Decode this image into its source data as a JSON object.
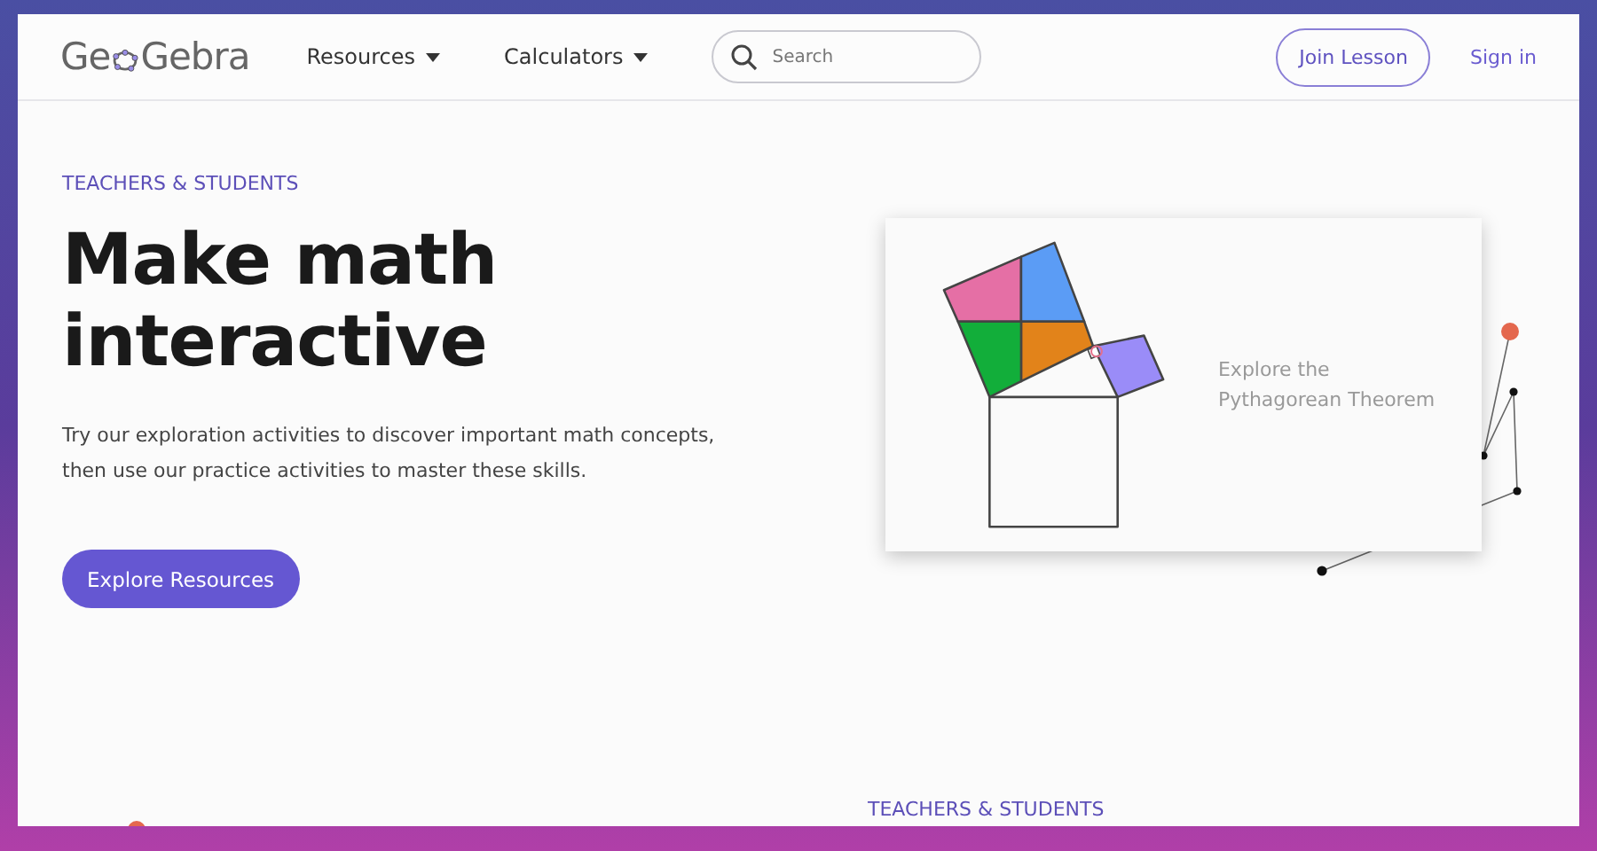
{
  "header": {
    "logo_start": "Ge",
    "logo_end": "Gebra",
    "nav": [
      {
        "label": "Resources"
      },
      {
        "label": "Calculators"
      }
    ],
    "search": {
      "placeholder": "Search"
    },
    "join_button": "Join Lesson",
    "sign_in": "Sign in"
  },
  "hero": {
    "eyebrow": "TEACHERS & STUDENTS",
    "headline": "Make math interactive",
    "description": "Try our exploration activities to discover important math concepts, then use our practice activities to master these skills.",
    "button": "Explore Resources"
  },
  "card": {
    "caption": "Explore the Pythagorean Theorem"
  },
  "next_section": {
    "eyebrow": "TEACHERS & STUDENTS"
  }
}
